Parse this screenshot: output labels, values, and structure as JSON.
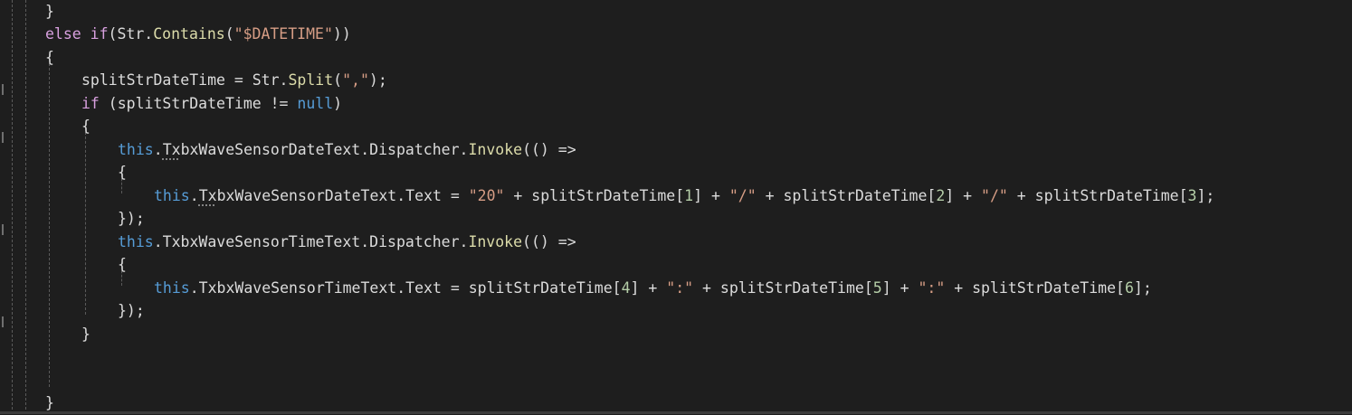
{
  "editor": {
    "language": "C#",
    "colors": {
      "background": "#1e1e1e",
      "text": "#dcdcdc",
      "keyword": "#569cd6",
      "control_keyword": "#d8a0df",
      "string": "#d69d85",
      "number": "#b5cea8",
      "method": "#dcdcaa",
      "indent_guide": "#5a5a5a"
    },
    "lines": [
      {
        "indent": 1,
        "tokens": [
          {
            "t": "}",
            "c": "p"
          }
        ]
      },
      {
        "indent": 1,
        "tokens": [
          {
            "t": "else if",
            "c": "kwc"
          },
          {
            "t": "(Str.",
            "c": "p"
          },
          {
            "t": "Contains",
            "c": "mth"
          },
          {
            "t": "(",
            "c": "p"
          },
          {
            "t": "\"$DATETIME\"",
            "c": "str"
          },
          {
            "t": "))",
            "c": "p"
          }
        ]
      },
      {
        "indent": 1,
        "tokens": [
          {
            "t": "{",
            "c": "p"
          }
        ]
      },
      {
        "indent": 2,
        "tokens": [
          {
            "t": "splitStrDateTime = Str.",
            "c": "p"
          },
          {
            "t": "Split",
            "c": "mth"
          },
          {
            "t": "(",
            "c": "p"
          },
          {
            "t": "\",\"",
            "c": "str"
          },
          {
            "t": ");",
            "c": "p"
          }
        ]
      },
      {
        "indent": 2,
        "tokens": [
          {
            "t": "if",
            "c": "kwc"
          },
          {
            "t": " (splitStrDateTime != ",
            "c": "p"
          },
          {
            "t": "null",
            "c": "kw"
          },
          {
            "t": ")",
            "c": "p"
          }
        ]
      },
      {
        "indent": 2,
        "tokens": [
          {
            "t": "{",
            "c": "p"
          }
        ]
      },
      {
        "indent": 3,
        "tokens": [
          {
            "t": "this",
            "c": "kw"
          },
          {
            "t": ".",
            "c": "p"
          },
          {
            "t": "Tx",
            "c": "sq"
          },
          {
            "t": "bxWaveSensorDateText.Dispatcher.",
            "c": "p"
          },
          {
            "t": "Invoke",
            "c": "mth"
          },
          {
            "t": "(() =>",
            "c": "p"
          }
        ]
      },
      {
        "indent": 3,
        "tokens": [
          {
            "t": "{",
            "c": "p"
          }
        ]
      },
      {
        "indent": 4,
        "tokens": [
          {
            "t": "this",
            "c": "kw"
          },
          {
            "t": ".",
            "c": "p"
          },
          {
            "t": "Tx",
            "c": "sq"
          },
          {
            "t": "bxWaveSensorDateText.Text = ",
            "c": "p"
          },
          {
            "t": "\"20\"",
            "c": "str"
          },
          {
            "t": " + splitStrDateTime[",
            "c": "p"
          },
          {
            "t": "1",
            "c": "num"
          },
          {
            "t": "] + ",
            "c": "p"
          },
          {
            "t": "\"/\"",
            "c": "str"
          },
          {
            "t": " + splitStrDateTime[",
            "c": "p"
          },
          {
            "t": "2",
            "c": "num"
          },
          {
            "t": "] + ",
            "c": "p"
          },
          {
            "t": "\"/\"",
            "c": "str"
          },
          {
            "t": " + splitStrDateTime[",
            "c": "p"
          },
          {
            "t": "3",
            "c": "num"
          },
          {
            "t": "];",
            "c": "p"
          }
        ]
      },
      {
        "indent": 3,
        "tokens": [
          {
            "t": "});",
            "c": "p"
          }
        ]
      },
      {
        "indent": 3,
        "tokens": [
          {
            "t": "this",
            "c": "kw"
          },
          {
            "t": ".TxbxWaveSensorTimeText.Dispatcher.",
            "c": "p"
          },
          {
            "t": "Invoke",
            "c": "mth"
          },
          {
            "t": "(() =>",
            "c": "p"
          }
        ]
      },
      {
        "indent": 3,
        "tokens": [
          {
            "t": "{",
            "c": "p"
          }
        ]
      },
      {
        "indent": 4,
        "tokens": [
          {
            "t": "this",
            "c": "kw"
          },
          {
            "t": ".TxbxWaveSensorTimeText.Text = splitStrDateTime[",
            "c": "p"
          },
          {
            "t": "4",
            "c": "num"
          },
          {
            "t": "] + ",
            "c": "p"
          },
          {
            "t": "\":\"",
            "c": "str"
          },
          {
            "t": " + splitStrDateTime[",
            "c": "p"
          },
          {
            "t": "5",
            "c": "num"
          },
          {
            "t": "] + ",
            "c": "p"
          },
          {
            "t": "\":\"",
            "c": "str"
          },
          {
            "t": " + splitStrDateTime[",
            "c": "p"
          },
          {
            "t": "6",
            "c": "num"
          },
          {
            "t": "];",
            "c": "p"
          }
        ]
      },
      {
        "indent": 3,
        "tokens": [
          {
            "t": "});",
            "c": "p"
          }
        ]
      },
      {
        "indent": 2,
        "tokens": [
          {
            "t": "}",
            "c": "p"
          }
        ]
      },
      {
        "indent": 0,
        "tokens": []
      },
      {
        "indent": 0,
        "tokens": []
      },
      {
        "indent": 1,
        "tokens": [
          {
            "t": "}",
            "c": "p"
          }
        ]
      }
    ]
  }
}
